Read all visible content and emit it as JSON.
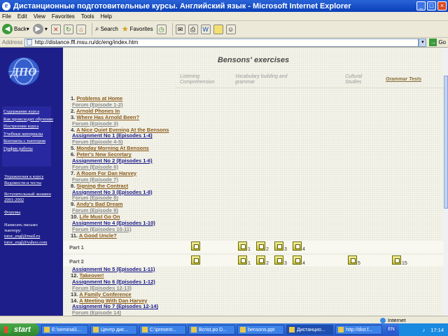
{
  "window": {
    "title": "Дистанционные подготовительные курсы. Английский язык - Microsoft Internet Explorer"
  },
  "menu": [
    "File",
    "Edit",
    "View",
    "Favorites",
    "Tools",
    "Help"
  ],
  "toolbar": {
    "back": "Back",
    "search": "Search",
    "favorites": "Favorites"
  },
  "address": {
    "label": "Address",
    "url": "http://distance.ffl.msu.ru/dc/eng/index.htm",
    "go": "Go"
  },
  "sidebar": {
    "logo": "ДПО",
    "nav": [
      "Содержание курса",
      "Как происходит обучение",
      "Построение курса",
      "Учебные материалы",
      "Контакты с тьютором",
      "График работы"
    ],
    "links": [
      "Упражнения к курсу",
      "Ведомости и тесты"
    ],
    "entrance": "Вступительный экзамен 2001-2002",
    "forum": "Форумы",
    "write_lines": [
      "Написать письмо",
      "тьютору:"
    ],
    "emails": [
      "tutor_engl@mail.ru",
      "tutor_engl@yahoo.com"
    ]
  },
  "page": {
    "title": "Bensons' exercises",
    "columns": [
      "Listening Comprehension",
      "Vocabulary building and grammar",
      "Cultural Studies",
      "Grammar Tests"
    ]
  },
  "episodes": [
    {
      "num": "1.",
      "title": "Problems at Home",
      "style": "brn"
    },
    {
      "num": "",
      "title": "Forum (Episode 1-2)",
      "style": "gry"
    },
    {
      "num": "2.",
      "title": "Arnold Phones In",
      "style": "brn"
    },
    {
      "num": "3.",
      "title": "Where Has Arnold Been?",
      "style": "brn"
    },
    {
      "num": "",
      "title": "Forum (Episode 3)",
      "style": "gry"
    },
    {
      "num": "4.",
      "title": "A Nice Quiet Evening At the Bensons",
      "style": "brn"
    },
    {
      "num": "",
      "title": "Assignment No 1 (Episodes 1-4)",
      "style": "blu"
    },
    {
      "num": "",
      "title": "Forum (Episode 4-5)",
      "style": "gry"
    },
    {
      "num": "5.",
      "title": "Monday Morning At Bensons",
      "style": "brn"
    },
    {
      "num": "6.",
      "title": "Peter's New Secretary",
      "style": "brn"
    },
    {
      "num": "",
      "title": "Assignment No 2 (Episodes 1-6)",
      "style": "blu"
    },
    {
      "num": "",
      "title": "Forum (Episode 6)",
      "style": "gry"
    },
    {
      "num": "7.",
      "title": "A Room For Dan Harvey",
      "style": "brn"
    },
    {
      "num": "",
      "title": "Forum (Episode 7)",
      "style": "gry"
    },
    {
      "num": "8.",
      "title": "Signing the Contract",
      "style": "brn"
    },
    {
      "num": "",
      "title": "Assignment No 3 (Episodes 1-8)",
      "style": "blu"
    },
    {
      "num": "",
      "title": "Forum (Episode 8)",
      "style": "gry"
    },
    {
      "num": "9.",
      "title": "Andy's Bad Dream",
      "style": "brn"
    },
    {
      "num": "",
      "title": "Forum (Episode 9)",
      "style": "gry"
    },
    {
      "num": "10.",
      "title": "Life Must Go On",
      "style": "brn"
    },
    {
      "num": "",
      "title": "Assignment No 4 (Episodes 1-10)",
      "style": "blu"
    },
    {
      "num": "",
      "title": "Forum (Episodes 10-11)",
      "style": "gry"
    },
    {
      "num": "11.",
      "title": "A Good Uncle?",
      "style": "brn"
    }
  ],
  "episodes2": [
    {
      "num": "",
      "title": "Assignment No 5 (Episodes 1-11)",
      "style": "blu"
    },
    {
      "num": "12.",
      "title": "Takeover!",
      "style": "brn"
    },
    {
      "num": "",
      "title": "Assignment No 6 (Episodes 1-12)",
      "style": "blu"
    },
    {
      "num": "",
      "title": "Forum (Episodes 12-13)",
      "style": "gry"
    },
    {
      "num": "13.",
      "title": "A Family Conference",
      "style": "brn"
    },
    {
      "num": "14.",
      "title": "A Meeting With Dan Harvey",
      "style": "brn"
    },
    {
      "num": "",
      "title": "Assignment No 7 (Episodes 12-14)",
      "style": "blu"
    },
    {
      "num": "",
      "title": "Forum (Episode 14)",
      "style": "gry"
    }
  ],
  "parts": [
    {
      "label": "Part 1",
      "exercises": [
        "",
        "1",
        "2",
        "3",
        "4"
      ]
    },
    {
      "label": "Part 2",
      "exercises": [
        "",
        "1",
        "2",
        "3",
        "4",
        "5",
        "15"
      ]
    }
  ],
  "status": {
    "zone": "Internet"
  },
  "taskbar": {
    "start": "start",
    "tasks": [
      "E:\\seminal1...",
      "Центр дис...",
      "C:\\present...",
      "Bcrist.po D...",
      "bensons.ppt",
      "Дистанцио...",
      "http://dist.f..."
    ],
    "lang": "EN",
    "clock": "17:14"
  }
}
